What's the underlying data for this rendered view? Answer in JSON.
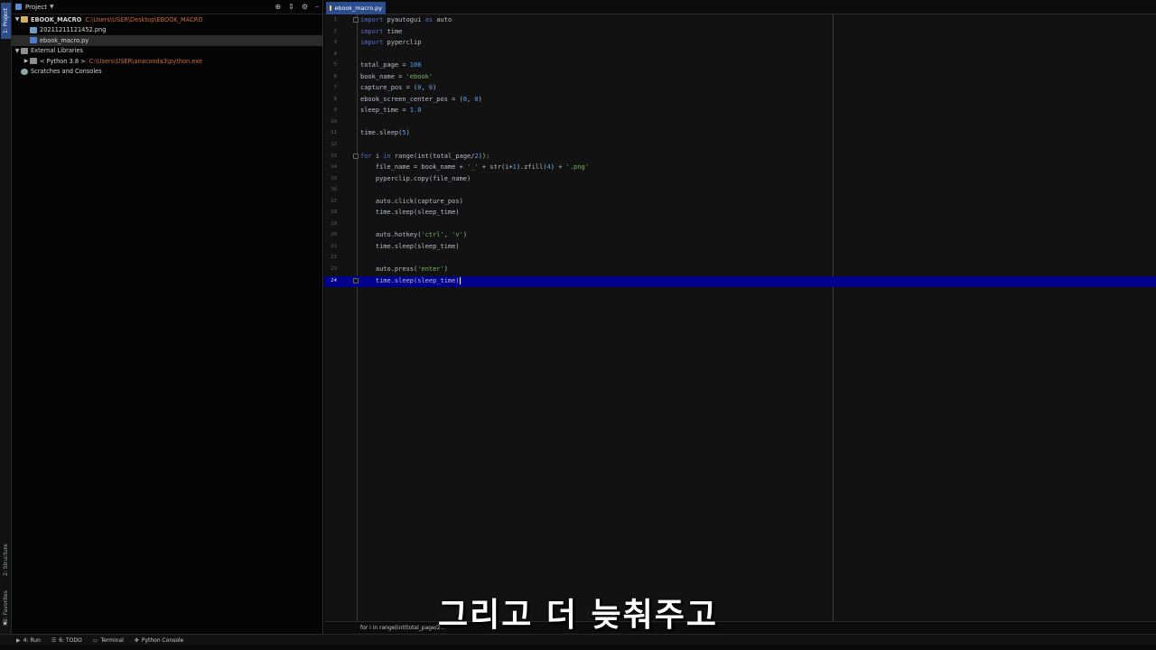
{
  "left_strip": {
    "project_tab": "1: Project",
    "structure_tab": "2: Structure",
    "favorites_tab": "2: Favorites"
  },
  "project_panel": {
    "header_title": "Project",
    "tree": [
      {
        "label": "EBOOK_MACRO",
        "path": "C:\\Users\\USER\\Desktop\\EBOOK_MACRO",
        "type": "folder",
        "level": 0,
        "expanded": true
      },
      {
        "label": "20211211121452.png",
        "type": "png",
        "level": 1
      },
      {
        "label": "ebook_macro.py",
        "type": "py",
        "level": 1,
        "selected": true
      },
      {
        "label": "External Libraries",
        "type": "lib",
        "level": 0,
        "expanded": true
      },
      {
        "label": "< Python 3.8 >",
        "path": "C:\\Users\\USER\\anaconda3\\python.exe",
        "type": "lib",
        "level": 1,
        "expanded": false
      },
      {
        "label": "Scratches and Consoles",
        "type": "scratch",
        "level": 0
      }
    ]
  },
  "editor": {
    "tab_label": "ebook_macro.py",
    "breadcrumb": "for i in range(int(total_page/2...",
    "current_line": 24,
    "lines": [
      "<span class=\"k\">import</span> pyautogui <span class=\"k\">as</span> auto",
      "<span class=\"k\">import</span> time",
      "<span class=\"k\">import</span> pyperclip",
      "",
      "total_page = <span class=\"n\">100</span>",
      "book_name = <span class=\"s\">'ebook'</span>",
      "capture_pos = (<span class=\"n\">0</span>, <span class=\"n\">0</span>)",
      "ebook_screen_center_pos = (<span class=\"n\">0</span>, <span class=\"n\">0</span>)",
      "sleep_time = <span class=\"n\">1.0</span>",
      "",
      "time.sleep(<span class=\"n\">5</span>)",
      "",
      "<span class=\"k\">for</span> i <span class=\"k\">in</span> range(int(total_page/<span class=\"n\">2</span>)):",
      "    file_name = book_name + <span class=\"s\">'_'</span> + str(i+<span class=\"n\">1</span>).zfill(<span class=\"n\">4</span>) + <span class=\"s\">'.png'</span>",
      "    pyperclip.copy(file_name)",
      "",
      "    auto.click(capture_pos)",
      "    time.sleep(sleep_time)",
      "",
      "    auto.hotkey(<span class=\"s\">'ctrl'</span>, <span class=\"s\">'v'</span>)",
      "    time.sleep(sleep_time)",
      "",
      "    auto.press(<span class=\"s\">'enter'</span>)",
      "    time.sleep(sleep_time)"
    ]
  },
  "subtitle": "그리고 더 늦춰주고",
  "bottom_bar": {
    "run": "4: Run",
    "todo": "6: TODO",
    "terminal": "Terminal",
    "python_console": "Python Console"
  }
}
